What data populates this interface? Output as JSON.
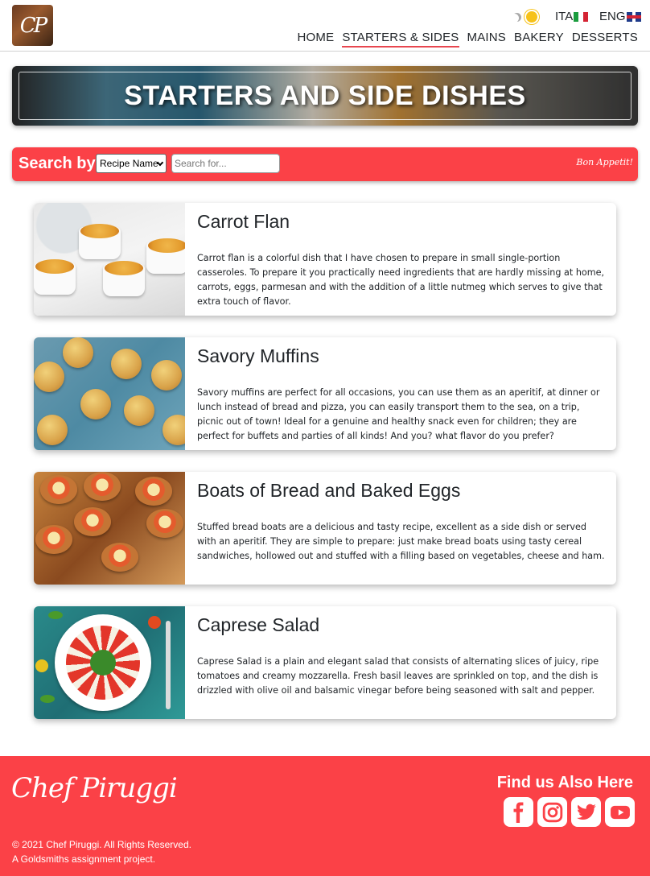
{
  "header": {
    "logo_text": "CP",
    "theme_icons": [
      "moon-icon",
      "sun-icon"
    ],
    "languages": [
      {
        "label": "ITA",
        "flag": "italy-flag-icon"
      },
      {
        "label": "ENG",
        "flag": "uk-flag-icon"
      }
    ],
    "nav": [
      {
        "label": "HOME"
      },
      {
        "label": "STARTERS & SIDES",
        "active": true
      },
      {
        "label": "MAINS"
      },
      {
        "label": "BAKERY"
      },
      {
        "label": "DESSERTS"
      }
    ]
  },
  "banner": {
    "title": "STARTERS AND SIDE DISHES"
  },
  "search": {
    "label": "Search by",
    "select_value": "Recipe Name",
    "placeholder": "Search for...",
    "tagline": "Bon Appetit!"
  },
  "recipes": [
    {
      "title": "Carrot Flan",
      "description": "Carrot flan is a colorful dish that I have chosen to prepare in small single-portion casseroles. To prepare it you practically need ingredients that are hardly missing at home, carrots, eggs, parmesan and with the addition of a little nutmeg which serves to give that extra touch of flavor."
    },
    {
      "title": "Savory Muffins",
      "description": "Savory muffins are perfect for all occasions, you can use them as an aperitif, at dinner or lunch instead of bread and pizza, you can easily transport them to the sea, on a trip, picnic out of town! Ideal for a genuine and healthy snack even for children; they are perfect for buffets and parties of all kinds! And you? what flavor do you prefer?"
    },
    {
      "title": "Boats of Bread and Baked Eggs",
      "description": "Stuffed bread boats are a delicious and tasty recipe, excellent as a side dish or served with an aperitif. They are simple to prepare: just make bread boats using tasty cereal sandwiches, hollowed out and stuffed with a filling based on vegetables, cheese and ham."
    },
    {
      "title": "Caprese Salad",
      "description": "Caprese Salad is a plain and elegant salad that consists of alternating slices of juicy, ripe tomatoes and creamy mozzarella. Fresh basil leaves are sprinkled on top, and the dish is drizzled with olive oil and balsamic vinegar before being seasoned with salt and pepper."
    }
  ],
  "footer": {
    "signature": "Chef Piruggi",
    "copyright": "© 2021 Chef Piruggi. All Rights Reserved.",
    "note": "A Goldsmiths assignment project.",
    "find_us": "Find us Also Here",
    "social": [
      "facebook-icon",
      "instagram-icon",
      "twitter-icon",
      "youtube-icon"
    ]
  },
  "colors": {
    "accent": "#fb4147",
    "active_underline": "#e8464f"
  }
}
